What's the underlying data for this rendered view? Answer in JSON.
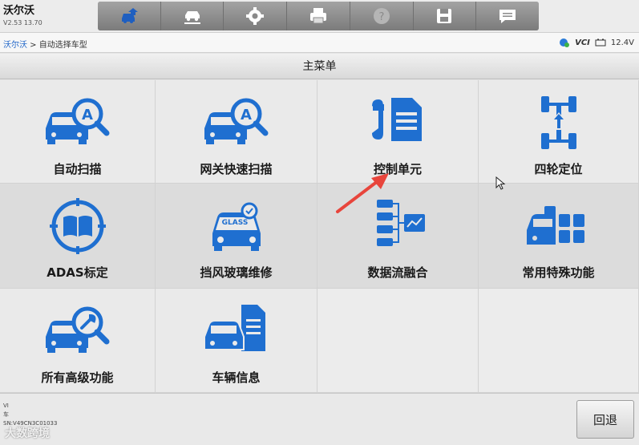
{
  "app": {
    "title": "沃尔沃",
    "version": "V2.53 13.70"
  },
  "toolbar": {
    "buttons": [
      {
        "icon": "car-home-icon"
      },
      {
        "icon": "car-lift-icon"
      },
      {
        "icon": "gear-icon"
      },
      {
        "icon": "printer-icon"
      },
      {
        "icon": "help-icon"
      },
      {
        "icon": "save-icon"
      },
      {
        "icon": "message-icon"
      }
    ]
  },
  "breadcrumb": {
    "root": "沃尔沃",
    "sep": " > ",
    "current": "自动选择车型"
  },
  "status": {
    "vci": "VCI",
    "voltage": "12.4V"
  },
  "title": "主菜单",
  "tiles": [
    {
      "label": "自动扫描",
      "icon": "auto-scan-icon"
    },
    {
      "label": "网关快速扫描",
      "icon": "gateway-scan-icon"
    },
    {
      "label": "控制单元",
      "icon": "control-unit-icon"
    },
    {
      "label": "四轮定位",
      "icon": "wheel-alignment-icon"
    },
    {
      "label": "ADAS标定",
      "icon": "adas-icon"
    },
    {
      "label": "挡风玻璃维修",
      "icon": "windshield-icon"
    },
    {
      "label": "数据流融合",
      "icon": "data-stream-icon"
    },
    {
      "label": "常用特殊功能",
      "icon": "special-functions-icon"
    },
    {
      "label": "所有高级功能",
      "icon": "advanced-functions-icon"
    },
    {
      "label": "车辆信息",
      "icon": "vehicle-info-icon"
    }
  ],
  "bottom": {
    "vin_line1": "VI",
    "vin_line2": "车",
    "serial": "SN:V49CN3C01033",
    "back_label": "回退"
  },
  "watermark": "大数跨境",
  "colors": {
    "accent": "#1e64c8",
    "icon_blue": "#1f6fd0"
  }
}
